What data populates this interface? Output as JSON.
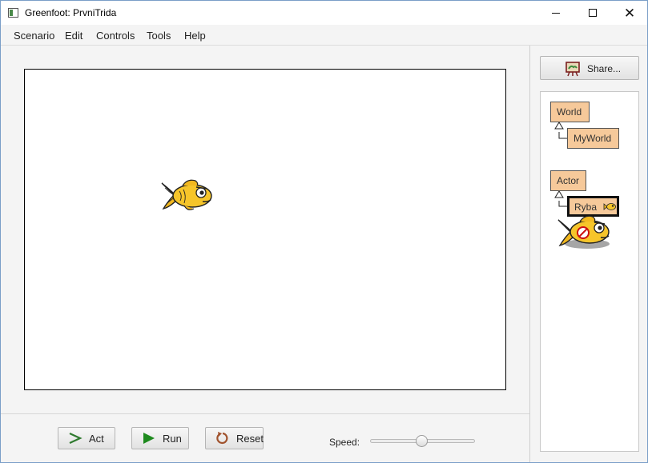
{
  "window": {
    "title": "Greenfoot: PrvniTrida",
    "minimize_icon": "minimize-icon",
    "maximize_icon": "maximize-icon",
    "close_icon": "close-icon",
    "close_glyph": "✕"
  },
  "menu": {
    "items": [
      "Scenario",
      "Edit",
      "Controls",
      "Tools",
      "Help"
    ]
  },
  "world": {
    "background": "#ffffff",
    "actor_icon": "fish-icon"
  },
  "controls": {
    "act_label": "Act",
    "run_label": "Run",
    "reset_label": "Reset",
    "speed_label": "Speed:",
    "speed_value": 0.5,
    "act_icon": "act-arrow-icon",
    "run_icon": "play-icon",
    "reset_icon": "reset-icon"
  },
  "sidebar": {
    "share_label": "Share...",
    "share_icon": "share-easel-icon",
    "classes": {
      "world_root": "World",
      "world_sub": "MyWorld",
      "actor_root": "Actor",
      "actor_sub": "Ryba"
    }
  },
  "colors": {
    "class_box": "#f6c99a",
    "run_icon": "#1e8a1e",
    "reset_icon": "#a0522d",
    "act_icon": "#2f7a2f"
  }
}
